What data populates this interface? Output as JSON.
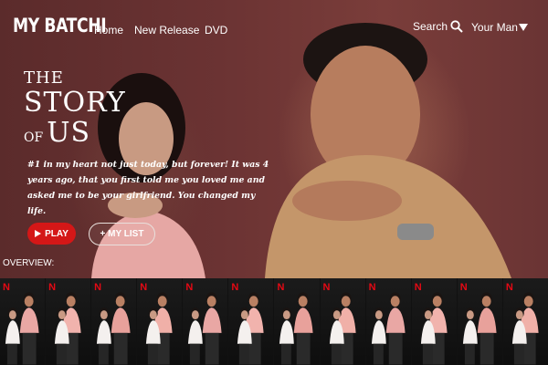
{
  "nav": {
    "logo": "MY BATCHI",
    "links": [
      "Home",
      "New Release",
      "DVD"
    ],
    "search_label": "Search",
    "user_label": "Your Man"
  },
  "hero": {
    "title_the": "THE",
    "title_story": "STORY",
    "title_of": "OF",
    "title_us": "US",
    "description": "#1 in my heart not just today, but forever! It was 4 years ago, that you first told me you loved me and asked me to be your girlfriend. You changed my life.",
    "play_label": "PLAY",
    "mylist_label": "+ MY LIST",
    "overview_label": "OVERVIEW:"
  },
  "thumbnails": {
    "badge": "N",
    "count": 12
  },
  "colors": {
    "background": "#6b3333",
    "play_button": "#d41717",
    "badge": "#e50914"
  },
  "icons": {
    "search": "search-icon",
    "user_menu": "caret-down-icon",
    "play": "play-icon"
  }
}
